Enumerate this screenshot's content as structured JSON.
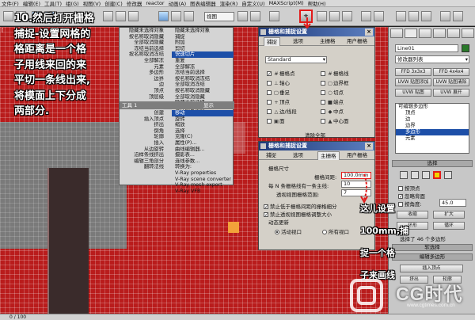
{
  "menubar": {
    "items": [
      "文件(F)",
      "编辑(E)",
      "工具(T)",
      "组(G)",
      "视图(V)",
      "创建(C)",
      "修改器",
      "reactor",
      "动画(A)",
      "图表编辑器",
      "渲染(R)",
      "自定义(U)",
      "MAXScript(M)",
      "帮助(H)"
    ]
  },
  "toolbar": {
    "view_dropdown": "视图"
  },
  "viewport": {
    "label": "[",
    "status_counter": "0 / 100"
  },
  "tutorial": {
    "lines": [
      "10.然后打开栅格",
      "捕捉-设置网格的",
      "格距离是一个格",
      "子用线来回的来",
      "平切一条线出来,",
      "将模面上下分成",
      "两部分."
    ],
    "highlight_word": "将模"
  },
  "note": {
    "lines": [
      "这儿设置",
      "100mm,捕",
      "捉一个格",
      "子来画线"
    ]
  },
  "context_menu": {
    "left_top": [
      "隐藏未选择对象",
      "按名称取消隐藏",
      "全部取消隐藏",
      "冻结当前选择",
      "按名称取消冻结",
      "全部解冻",
      "元素",
      "多边形",
      "边界",
      "边",
      "顶点",
      "顶层级"
    ],
    "right_top": [
      "隐藏未选择对象",
      "捕捉",
      "附加",
      "剪切",
      "快速切片",
      "重复",
      "全部解冻",
      "冻结当前选择",
      "按名称取消冻结",
      "全部取消冻结",
      "按名称取消隐藏",
      "全部取消隐藏",
      "隐藏当前选择",
      "保存场景状态",
      "管理场景状态"
    ],
    "highlight_item": "快速切片",
    "left_sub": [
      "转换到边",
      "转换到顶点",
      "元素",
      "多边形",
      "边界",
      "边",
      "顶点",
      "顶层级"
    ],
    "section_left": "工具 1",
    "section_right": "显示",
    "tools_left_label": "工具 2",
    "tools_right_label": "变换",
    "left_low": [
      "创建",
      "插入顶点",
      "挤出",
      "倒角",
      "轮廓",
      "插入",
      "从边旋转",
      "沿样条线挤出",
      "编辑三角剖分",
      "翻转法线"
    ],
    "right_low": [
      "移动",
      "旋转",
      "缩放",
      "选择",
      "克隆(C)",
      "属性(P)...",
      "曲线编辑器...",
      "摄影表...",
      "连线参数...",
      "转换为:",
      "V-Ray properties",
      "V-Ray scene converter",
      "V-Ray mesh export",
      "V-Ray VFB"
    ],
    "right_low_highlight": "移动"
  },
  "dialog_top": {
    "title": "栅格和捕捉设置",
    "tabs": [
      "捕捉",
      "选项",
      "主栅格",
      "用户栅格"
    ],
    "active_tab": "捕捉",
    "dropdown": "Standard",
    "snaps": [
      {
        "symbol": "#",
        "label": "栅格点",
        "on": true
      },
      {
        "symbol": "⊥",
        "label": "轴心",
        "on": false
      },
      {
        "symbol": "▢",
        "label": "垂足",
        "on": false
      },
      {
        "symbol": "+",
        "label": "顶点",
        "on": false
      },
      {
        "symbol": "△",
        "label": "边/线段",
        "on": false
      },
      {
        "symbol": "▣",
        "label": "面",
        "on": false
      }
    ],
    "snaps_right": [
      {
        "symbol": "#",
        "label": "栅格线",
        "on": false
      },
      {
        "symbol": "▢",
        "label": "边界框",
        "on": false
      },
      {
        "symbol": "○",
        "label": "切点",
        "on": false
      },
      {
        "symbol": "■",
        "label": "端点",
        "on": false
      },
      {
        "symbol": "◆",
        "label": "中点",
        "on": false
      },
      {
        "symbol": "▲",
        "label": "中心面",
        "on": false
      }
    ],
    "clear_button": "清除全部"
  },
  "dialog_bottom": {
    "title": "栅格和捕捉设置",
    "tabs": [
      "捕捉",
      "选项",
      "主栅格",
      "用户栅格"
    ],
    "active_tab": "主栅格",
    "group_label": "栅格尺寸",
    "grid_spacing_label": "栅格间距:",
    "grid_spacing_value": "100.0mm",
    "major_lines_label": "每 N 条栅格线有一条主线:",
    "major_lines_value": "10",
    "perspective_extent_label": "透视视图栅格范围:",
    "perspective_extent_value": "7",
    "checkbox_1": "禁止低于栅格间距的栅格细分",
    "checkbox_2": "禁止透视视图栅格调整大小",
    "dynamic_label": "动态更新",
    "radio_active": "活动视口",
    "radio_all": "所有视口"
  },
  "command_panel": {
    "object_name": "Line01",
    "modifier_list": "修改器列表",
    "buttons": [
      "FFD 3x3x3",
      "FFD 4x4x4",
      "UVW 贴图添加",
      "UVW 贴图清除",
      "UVW 贴图",
      "UVW 展开"
    ],
    "stack": [
      "可编辑多边形",
      "顶点",
      "边",
      "边界",
      "多边形",
      "元素"
    ],
    "stack_selected": "多边形",
    "selection_rollout": "选择",
    "by_vertex": "按顶点",
    "ignore_backfacing": "忽略背面",
    "by_angle_label": "按角度:",
    "by_angle_value": "45.0",
    "shrink": "收缩",
    "grow": "扩大",
    "ring": "环形",
    "loop": "循环",
    "selected_count": "选择了 46 个多边形",
    "soft_selection": "软选择",
    "edit_polygons": "编辑多边形",
    "insert_vertex": "插入顶点",
    "extrude": "挤出",
    "outline": "轮廓"
  },
  "watermark": {
    "brand": "CG时代",
    "url": "www.cgtimes.com.cn"
  },
  "colors": {
    "viewport_red": "#b91c1c",
    "highlight_blue": "#1d4fa8",
    "tutorial_yellow": "#ffd200",
    "annotation_red": "#e21b1b"
  }
}
